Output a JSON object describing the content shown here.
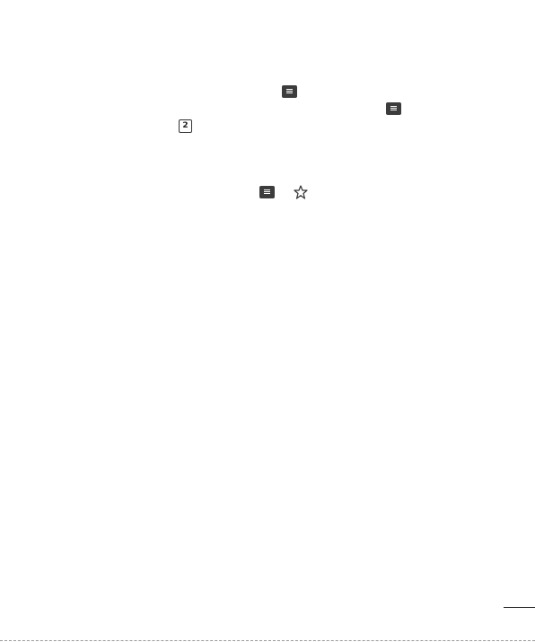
{
  "page": {
    "inline_icons": [
      {
        "name": "menu-icon"
      },
      {
        "name": "menu-icon"
      },
      {
        "name": "number-two-box-icon",
        "text": "2"
      },
      {
        "name": "menu-icon"
      },
      {
        "name": "star-outline-icon"
      }
    ]
  }
}
